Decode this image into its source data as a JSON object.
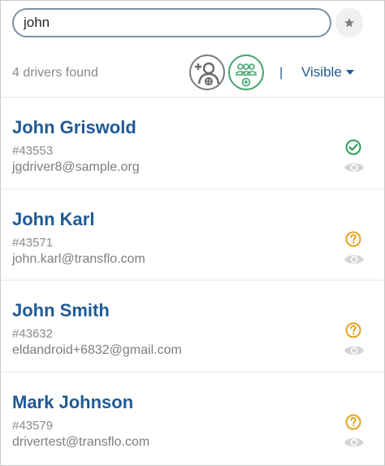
{
  "search": {
    "value": "john"
  },
  "toolbar": {
    "result_count": "4 drivers found",
    "separator": "|",
    "visibility_filter": "Visible"
  },
  "drivers": [
    {
      "name": "John Griswold",
      "id": "#43553",
      "email": "jgdriver8@sample.org",
      "status": "verified",
      "status_icon": "check-circle-icon",
      "status_color": "#2e9e5b"
    },
    {
      "name": "John Karl",
      "id": "#43571",
      "email": "john.karl@transflo.com",
      "status": "unknown",
      "status_icon": "question-circle-icon",
      "status_color": "#e8a21a"
    },
    {
      "name": "John Smith",
      "id": "#43632",
      "email": "eldandroid+6832@gmail.com",
      "status": "unknown",
      "status_icon": "question-circle-icon",
      "status_color": "#e8a21a"
    },
    {
      "name": "Mark Johnson",
      "id": "#43579",
      "email": "drivertest@transflo.com",
      "status": "unknown",
      "status_icon": "question-circle-icon",
      "status_color": "#e8a21a"
    }
  ],
  "colors": {
    "accent": "#1e5a96",
    "group_green": "#43a56e",
    "muted_text": "#8a8a8a",
    "eye_gray": "#d0d0d0"
  }
}
